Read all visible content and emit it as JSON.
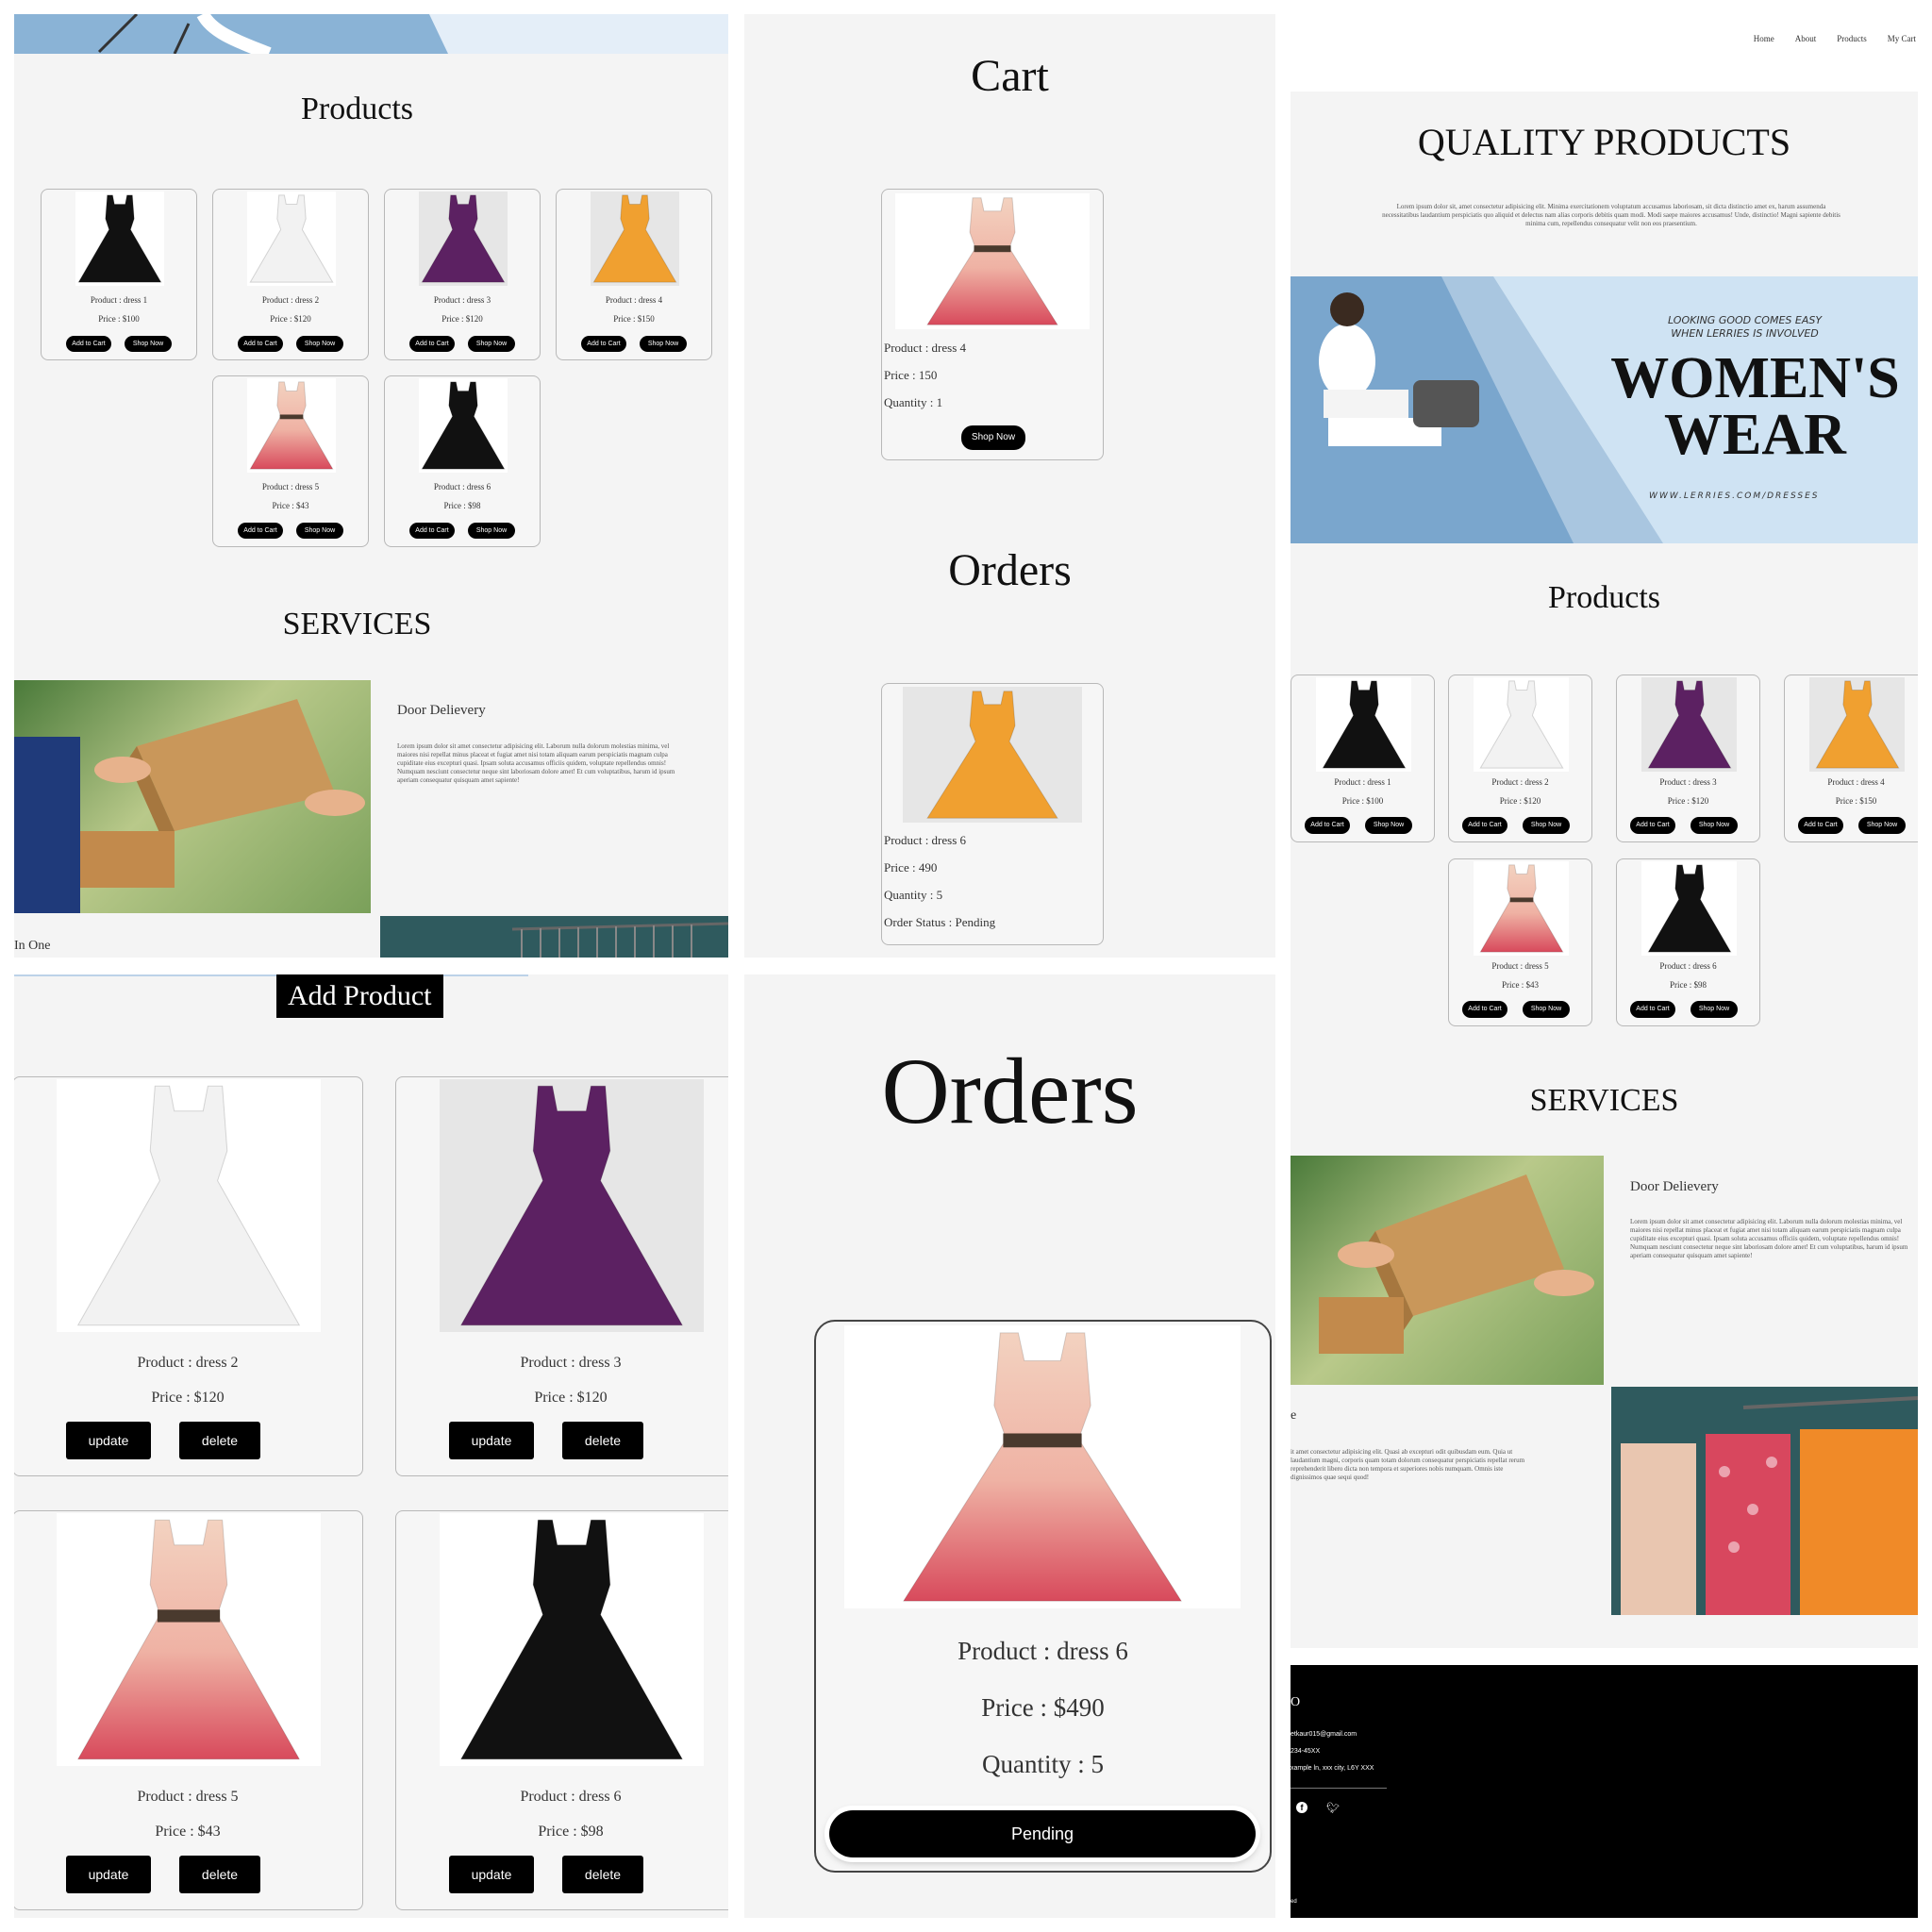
{
  "products_panel": {
    "title": "Products",
    "services_title": "SERVICES",
    "service_title": "Door Delievery",
    "service_text": "Lorem ipsum dolor sit amet consectetur adipisicing elit. Laborum nulla dolorum molestias minima, vel maiores nisi repellat minus placeat et fugiat amet nisi totam aliquam earum perspiciatis magnam culpa cupiditate eius excepturi quasi. Ipsam soluta accusamus officiis quidem, voluptate repellendus omnis! Numquam nesciunt consectetur neque sint laboriosam dolore amet! Et cum voluptatibus, harum id ipsum aperiam consequatur quisquam amet sapiente!",
    "in_one_label": "In One",
    "add_to_cart_label": "Add to Cart",
    "shop_now_label": "Shop Now",
    "products": [
      {
        "name": "Product : dress 1",
        "price": "Price : $100",
        "color": "#111111"
      },
      {
        "name": "Product : dress 2",
        "price": "Price : $120",
        "color": "#f2f2f2"
      },
      {
        "name": "Product : dress 3",
        "price": "Price : $120",
        "color": "#5c2162"
      },
      {
        "name": "Product : dress 4",
        "price": "Price : $150",
        "color": "#f0a030"
      },
      {
        "name": "Product : dress 5",
        "price": "Price : $43",
        "color": "#e87a80"
      },
      {
        "name": "Product : dress 6",
        "price": "Price : $98",
        "color": "#111111"
      }
    ]
  },
  "cart_panel": {
    "cart_title": "Cart",
    "cart_item": {
      "product": "Product : dress 4",
      "price": "Price : 150",
      "quantity": "Quantity : 1",
      "button": "Shop Now"
    },
    "orders_title": "Orders",
    "order_item": {
      "product": "Product : dress 6",
      "price": "Price : 490",
      "quantity": "Quantity : 5",
      "status": "Order Status : Pending"
    }
  },
  "home_panel": {
    "nav": [
      "Home",
      "About",
      "Products",
      "My Cart"
    ],
    "quality_title": "QUALITY PRODUCTS",
    "quality_text": "Lorem ipsum dolor sit, amet consectetur adipisicing elit. Minima exercitationem voluptatum accusamus laboriosam, sit dicta distinctio amet ex, harum assumenda necessitatibus laudantium perspiciatis quo aliquid et delectus nam alias corporis debitis quam modi. Modi saepe maiores accusamus! Unde, distinctio! Magni sapiente debitis minima cum, repellendus consequatur velit non eos praesentium.",
    "banner": {
      "tagline_1": "LOOKING GOOD COMES EASY",
      "tagline_2": "WHEN LERRIES IS INVOLVED",
      "headline_1": "WOMEN'S",
      "headline_2": "WEAR",
      "url": "WWW.LERRIES.COM/DRESSES"
    },
    "products_title": "Products",
    "services_title": "SERVICES",
    "service_title": "Door Delievery",
    "service_text": "Lorem ipsum dolor sit amet consectetur adipisicing elit. Laborum nulla dolorum molestias minima, vel maiores nisi repellat minus placeat et fugiat amet nisi totam aliquam earum perspiciatis magnam culpa cupiditate eius excepturi quasi. Ipsam soluta accusamus officiis quidem, voluptate repellendus omnis! Numquam nesciunt consectetur neque sint laboriosam dolore amet! Et cum voluptatibus, harum id ipsum aperiam consequatur quisquam amet sapiente!",
    "service2_title": "e",
    "service2_text": "it amet consectetur adipisicing elit. Quasi ab excepturi odit quibusdam eum. Quia ut laudantium magni, corporis quam totam dolorum consequatur perspiciatis repellat rerum reprehenderit libero dicta non tempora et superiores nobis numquam. Omnis iste dignissimos quae sequi quod!",
    "footer": {
      "logo": "O",
      "email": "etkaur015@gmail.com",
      "phone": "234-45XX",
      "address": "xample ln, xxx city, L6Y XXX",
      "copyright": "ed"
    }
  },
  "add_product_panel": {
    "title": "Add Product",
    "update_label": "update",
    "delete_label": "delete",
    "products": [
      {
        "name": "Product : dress 2",
        "price": "Price : $120",
        "color": "#f2f2f2"
      },
      {
        "name": "Product : dress 3",
        "price": "Price : $120",
        "color": "#5c2162"
      },
      {
        "name": "Product : dress 5",
        "price": "Price : $43",
        "color": "#e87a80"
      },
      {
        "name": "Product : dress 6",
        "price": "Price : $98",
        "color": "#111111"
      }
    ]
  },
  "orders_panel": {
    "title": "Orders",
    "product": "Product : dress 6",
    "price": "Price : $490",
    "quantity": "Quantity : 5",
    "status_button": "Pending"
  }
}
